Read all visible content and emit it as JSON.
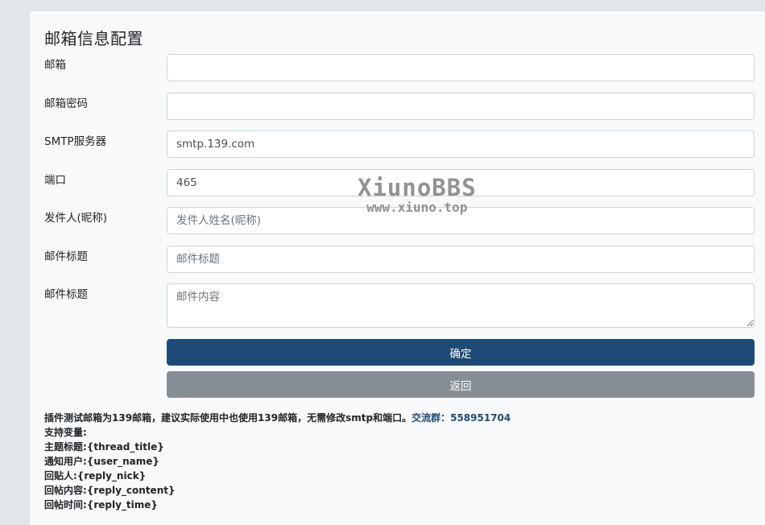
{
  "form": {
    "title": "邮箱信息配置",
    "fields": [
      {
        "label": "邮箱",
        "value": "",
        "placeholder": ""
      },
      {
        "label": "邮箱密码",
        "value": "",
        "placeholder": ""
      },
      {
        "label": "SMTP服务器",
        "value": "smtp.139.com",
        "placeholder": ""
      },
      {
        "label": "端口",
        "value": "465",
        "placeholder": ""
      },
      {
        "label": "发件人(昵称)",
        "value": "",
        "placeholder": "发件人姓名(昵称)"
      },
      {
        "label": "邮件标题",
        "value": "",
        "placeholder": "邮件标题"
      },
      {
        "label": "邮件标题",
        "value": "",
        "placeholder": "邮件内容"
      }
    ],
    "confirm_label": "确定",
    "back_label": "返回"
  },
  "notes": {
    "line1": "插件测试邮箱为139邮箱，建议实际使用中也使用139邮箱，无需修改smtp和端口。",
    "group_label": "交流群：",
    "group_number": "558951704",
    "vars_heading": "支持变量:",
    "vars": [
      "主题标题:{thread_title}",
      "通知用户:{user_name}",
      "回贴人:{reply_nick}",
      "回帖内容:{reply_content}",
      "回帖时间:{reply_time}"
    ]
  },
  "watermark": {
    "main": "XiunoBBS",
    "sub": "www.xiuno.top"
  }
}
